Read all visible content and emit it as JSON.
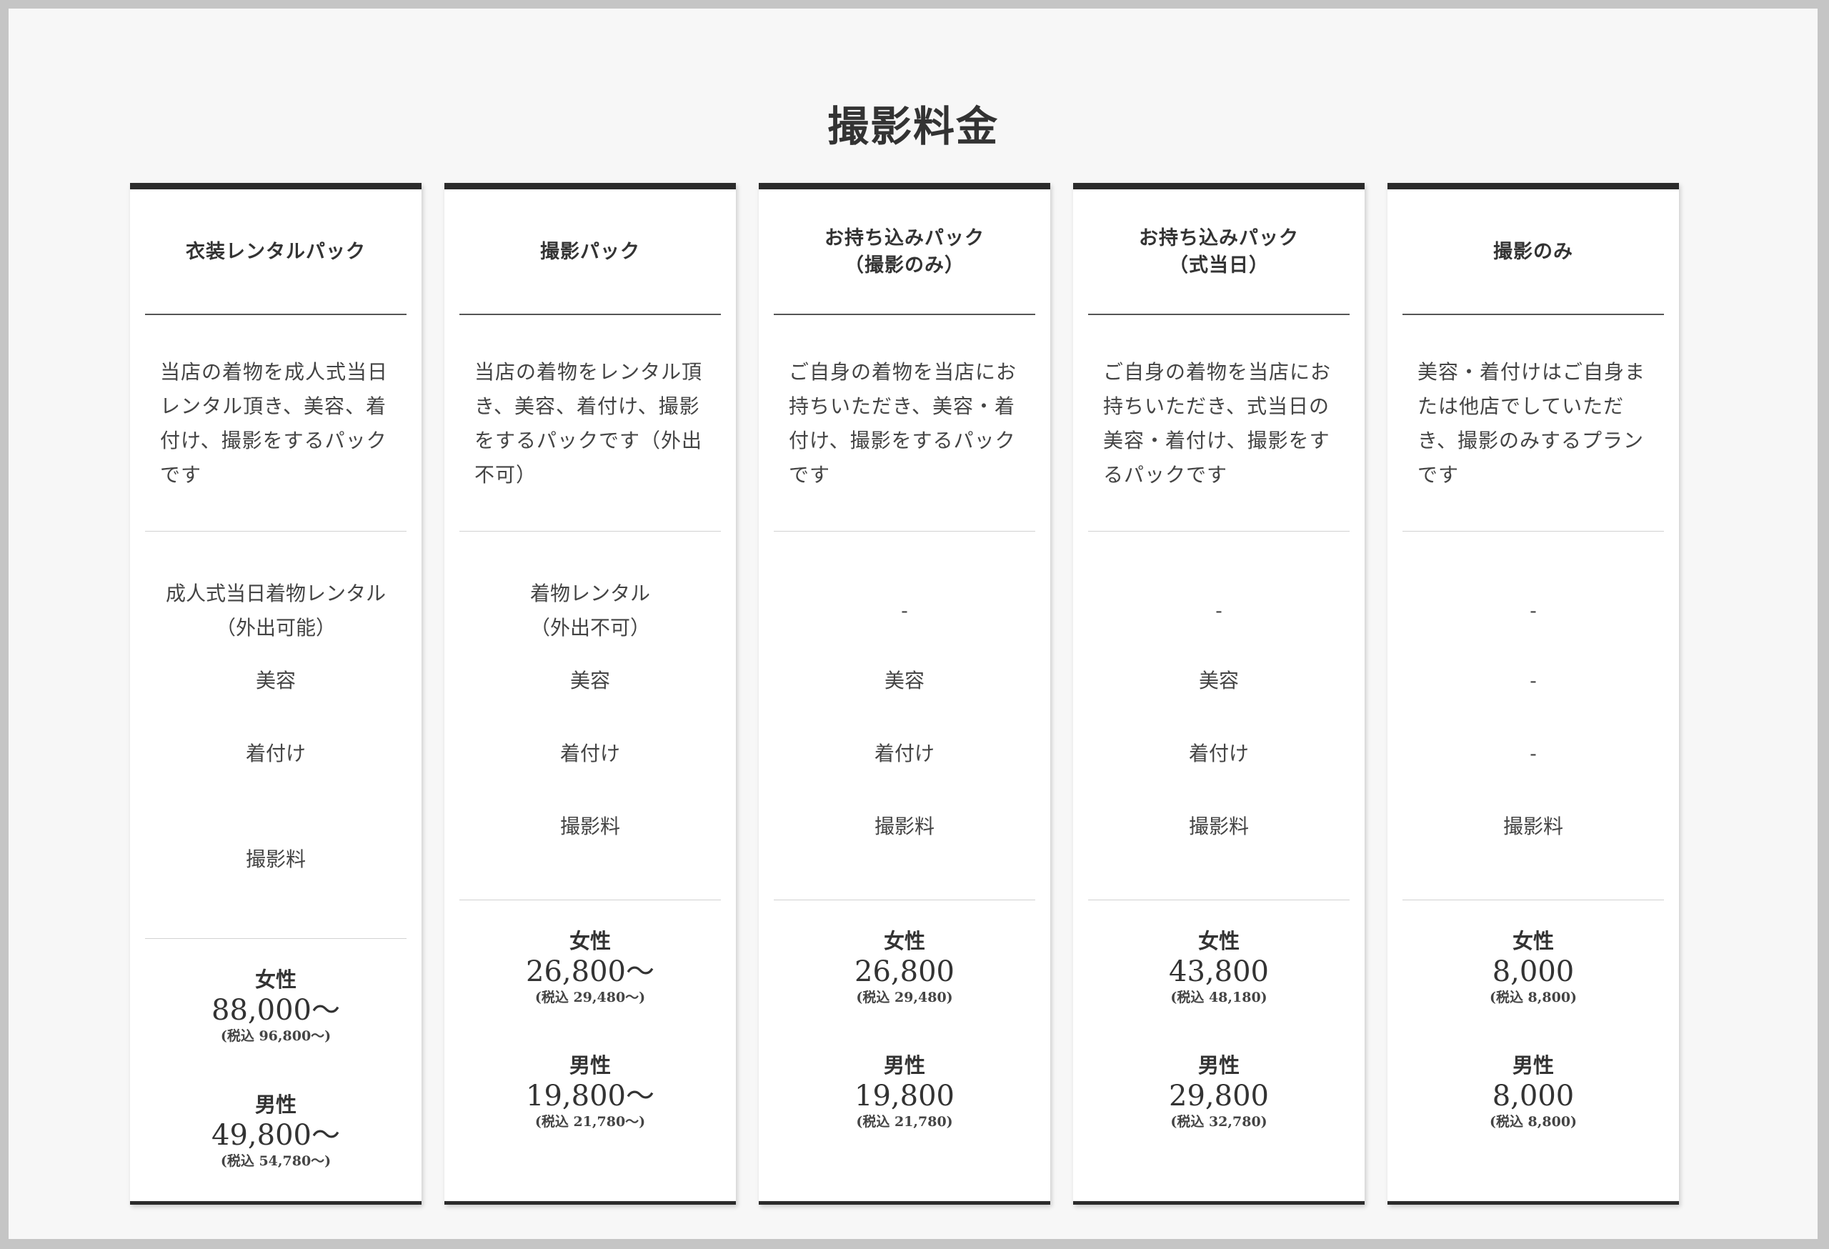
{
  "title": "撮影料金",
  "plans": [
    {
      "name": "衣装レンタルパック",
      "description": "当店の着物を成人式当日レンタル頂き、美容、着付け、撮影をするパックです",
      "features": {
        "rental": "成人式当日着物レンタル\n（外出可能）",
        "beauty": "美容",
        "dressing": "着付け",
        "photo": "撮影料"
      },
      "female_label": "女性",
      "female_price": "88,000〜",
      "female_tax": "(税込 96,800〜)",
      "male_label": "男性",
      "male_price": "49,800〜",
      "male_tax": "(税込 54,780〜)"
    },
    {
      "name": "撮影パック",
      "description": "当店の着物をレンタル頂き、美容、着付け、撮影をするパックです（外出不可）",
      "features": {
        "rental": "着物レンタル\n（外出不可）",
        "beauty": "美容",
        "dressing": "着付け",
        "photo": "撮影料"
      },
      "female_label": "女性",
      "female_price": "26,800〜",
      "female_tax": "(税込 29,480〜)",
      "male_label": "男性",
      "male_price": "19,800〜",
      "male_tax": "(税込 21,780〜)"
    },
    {
      "name": "お持ち込みパック\n（撮影のみ）",
      "description": "ご自身の着物を当店にお持ちいただき、美容・着付け、撮影をするパックです",
      "features": {
        "rental": "-",
        "beauty": "美容",
        "dressing": "着付け",
        "photo": "撮影料"
      },
      "female_label": "女性",
      "female_price": "26,800",
      "female_tax": "(税込 29,480)",
      "male_label": "男性",
      "male_price": "19,800",
      "male_tax": "(税込 21,780)"
    },
    {
      "name": "お持ち込みパック\n（式当日）",
      "description": "ご自身の着物を当店にお持ちいただき、式当日の美容・着付け、撮影をするパックです",
      "features": {
        "rental": "-",
        "beauty": "美容",
        "dressing": "着付け",
        "photo": "撮影料"
      },
      "female_label": "女性",
      "female_price": "43,800",
      "female_tax": "(税込 48,180)",
      "male_label": "男性",
      "male_price": "29,800",
      "male_tax": "(税込 32,780)"
    },
    {
      "name": "撮影のみ",
      "description": "美容・着付けはご自身または他店でしていただき、撮影のみするプランです",
      "features": {
        "rental": "-",
        "beauty": "-",
        "dressing": "-",
        "photo": "撮影料"
      },
      "female_label": "女性",
      "female_price": "8,000",
      "female_tax": "(税込 8,800)",
      "male_label": "男性",
      "male_price": "8,000",
      "male_tax": "(税込 8,800)"
    }
  ]
}
